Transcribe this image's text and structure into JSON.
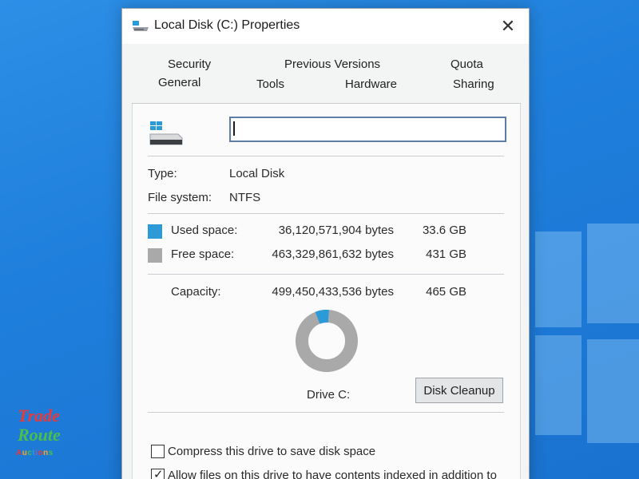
{
  "window": {
    "title": "Local Disk (C:) Properties",
    "close_glyph": "✕"
  },
  "tabs": {
    "row1": [
      {
        "label": "Security"
      },
      {
        "label": "Previous Versions"
      },
      {
        "label": "Quota"
      }
    ],
    "row2": [
      {
        "label": "General"
      },
      {
        "label": "Tools"
      },
      {
        "label": "Hardware"
      },
      {
        "label": "Sharing"
      }
    ],
    "active": "General"
  },
  "general": {
    "name_value": "",
    "type_label": "Type:",
    "type_value": "Local Disk",
    "fs_label": "File system:",
    "fs_value": "NTFS",
    "used_label": "Used space:",
    "used_bytes": "36,120,571,904 bytes",
    "used_gb": "33.6 GB",
    "free_label": "Free space:",
    "free_bytes": "463,329,861,632 bytes",
    "free_gb": "431 GB",
    "capacity_label": "Capacity:",
    "capacity_bytes": "499,450,433,536 bytes",
    "capacity_gb": "465 GB",
    "drive_label": "Drive C:",
    "cleanup_label": "Disk Cleanup",
    "used_fraction": 0.072,
    "compress_label": "Compress this drive to save disk space",
    "compress_checked": false,
    "index_label": "Allow files on this drive to have contents indexed in addition to",
    "index_checked": true
  },
  "colors": {
    "used": "#2b9ad6",
    "free": "#a9a9a9",
    "accent": "#5f7ea7"
  },
  "icons": {
    "drive": "drive-icon",
    "close": "close-icon"
  },
  "logo": {
    "line1": "Trade",
    "line2": "Route",
    "line3": "Auctions"
  }
}
